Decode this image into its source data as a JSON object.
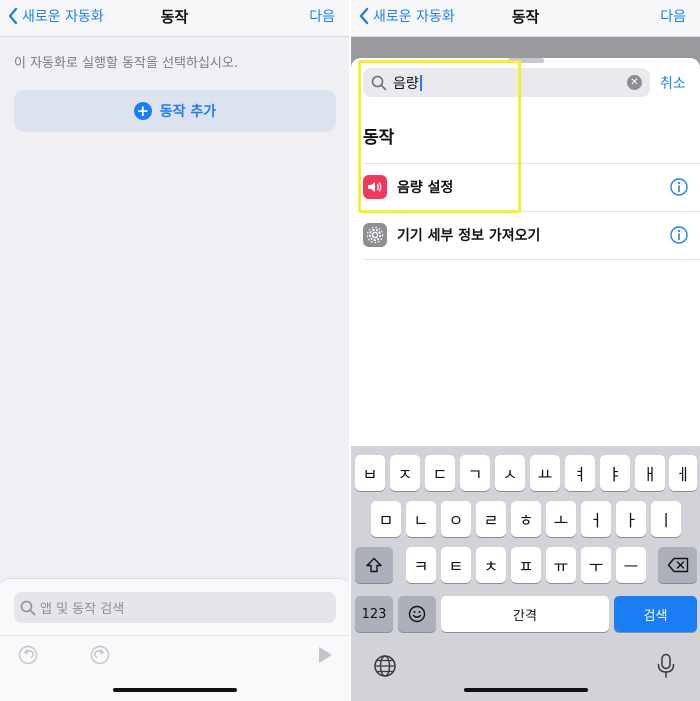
{
  "left": {
    "nav": {
      "back_label": "새로운 자동화",
      "title": "동작",
      "next_label": "다음"
    },
    "instruction": "이 자동화로 실행할 동작을 선택하십시오.",
    "add_action_label": "동작 추가",
    "bottom_search_placeholder": "앱 및 동작 검색"
  },
  "right": {
    "nav": {
      "back_label": "새로운 자동화",
      "title": "동작",
      "next_label": "다음"
    },
    "search_value": "음량",
    "cancel_label": "취소",
    "section_title": "동작",
    "results": [
      {
        "label": "음량 설정",
        "icon": "speaker-icon",
        "icon_color": "#f2375d"
      },
      {
        "label": "기기 세부 정보 가져오기",
        "icon": "gear-icon",
        "icon_color": "#8e8e93"
      }
    ],
    "highlight_color": "#f4ee3a",
    "keyboard": {
      "row1": [
        "ㅂ",
        "ㅈ",
        "ㄷ",
        "ㄱ",
        "ㅅ",
        "ㅛ",
        "ㅕ",
        "ㅑ",
        "ㅐ",
        "ㅔ"
      ],
      "row2": [
        "ㅁ",
        "ㄴ",
        "ㅇ",
        "ㄹ",
        "ㅎ",
        "ㅗ",
        "ㅓ",
        "ㅏ",
        "ㅣ"
      ],
      "row3": [
        "ㅋ",
        "ㅌ",
        "ㅊ",
        "ㅍ",
        "ㅠ",
        "ㅜ",
        "ㅡ"
      ],
      "numbers_label": "123",
      "space_label": "간격",
      "search_label": "검색"
    }
  },
  "colors": {
    "accent": "#1c7ef5"
  }
}
